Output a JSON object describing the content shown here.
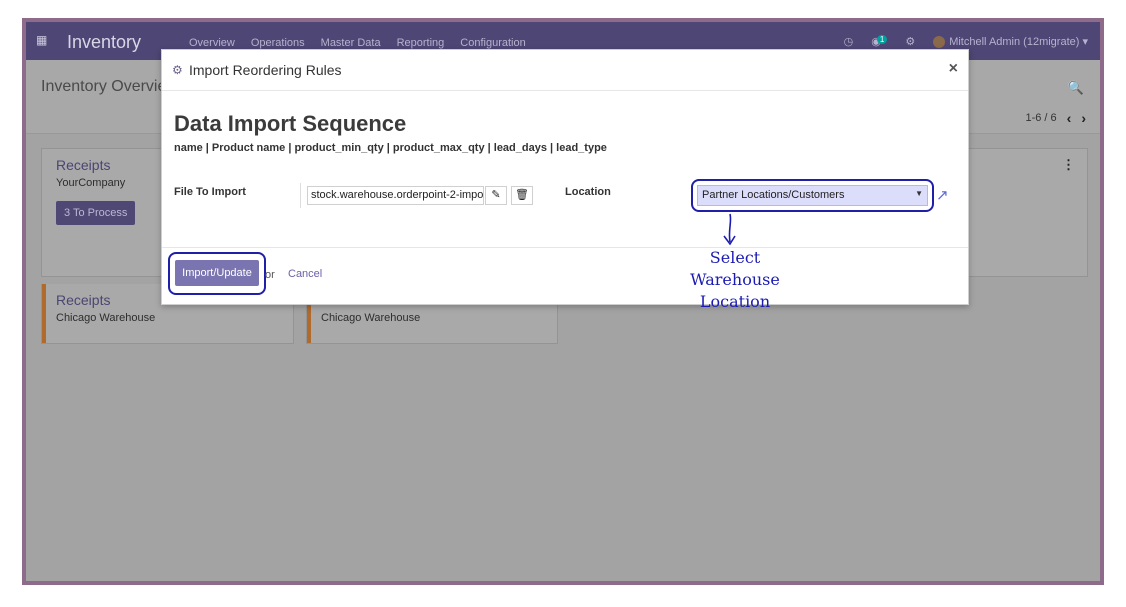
{
  "navbar": {
    "app_title": "Inventory",
    "menu": [
      "Overview",
      "Operations",
      "Master Data",
      "Reporting",
      "Configuration"
    ],
    "chat_badge": "1",
    "user": "Mitchell Admin (12migrate)"
  },
  "control": {
    "breadcrumb": "Inventory Overview",
    "pager": "1-6 / 6"
  },
  "cards": [
    {
      "title": "Receipts",
      "company": "YourCompany",
      "button": "3 To Process"
    },
    {
      "title": "Receipts",
      "company": "Chicago Warehouse"
    },
    {
      "company": "Chicago Warehouse"
    }
  ],
  "modal": {
    "title": "Import Reordering Rules",
    "heading": "Data Import Sequence",
    "columns": "name | Product name | product_min_qty | product_max_qty | lead_days | lead_type",
    "file_label": "File To Import",
    "file_value": "stock.warehouse.orderpoint-2-impo",
    "location_label": "Location",
    "location_value": "Partner Locations/Customers",
    "import_button": "Import/Update",
    "or_text": "or",
    "cancel_label": "Cancel"
  },
  "annotation": {
    "line1": "Select  Warehouse",
    "line2": "Location",
    "color": "#1b1bb3"
  },
  "colors": {
    "navbar": "#4e4674",
    "primary": "#7a74b0",
    "highlight": "#1f1fa8"
  }
}
